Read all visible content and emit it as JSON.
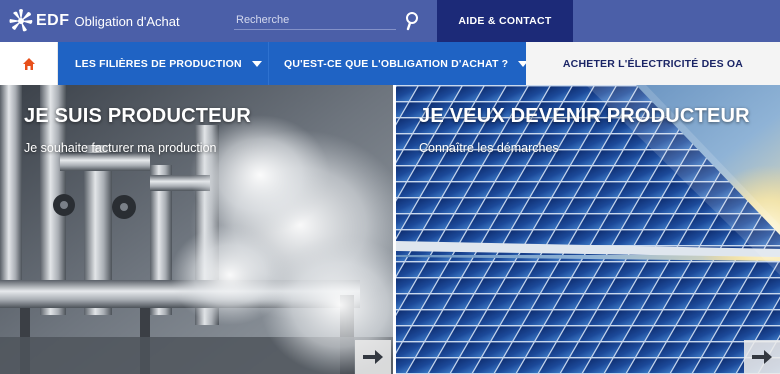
{
  "header": {
    "brand_logo_text": "EDF",
    "site_name": "Obligation d'Achat",
    "search_placeholder": "Recherche",
    "help_contact_label": "AIDE & CONTACT"
  },
  "nav": {
    "home_icon": "home-icon",
    "items": [
      {
        "label": "LES FILIÈRES DE PRODUCTION",
        "has_dropdown": true
      },
      {
        "label": "QU'EST-CE QUE L'OBLIGATION D'ACHAT ?",
        "has_dropdown": true
      }
    ],
    "buy_label": "ACHETER L'ÉLECTRICITÉ DES OA"
  },
  "heroes": [
    {
      "title": "JE SUIS PRODUCTEUR",
      "subtitle": "Je souhaite facturer ma production",
      "arrow_icon": "arrow-right-icon"
    },
    {
      "title": "JE VEUX DEVENIR PRODUCTEUR",
      "subtitle": "Connaître les démarches",
      "arrow_icon": "arrow-right-icon"
    }
  ],
  "colors": {
    "header_bg": "#4b5fa8",
    "help_bg": "#1c2a78",
    "nav_blue": "#1f63c4",
    "nav_light": "#f4f4f4",
    "home_icon": "#e8501b"
  }
}
